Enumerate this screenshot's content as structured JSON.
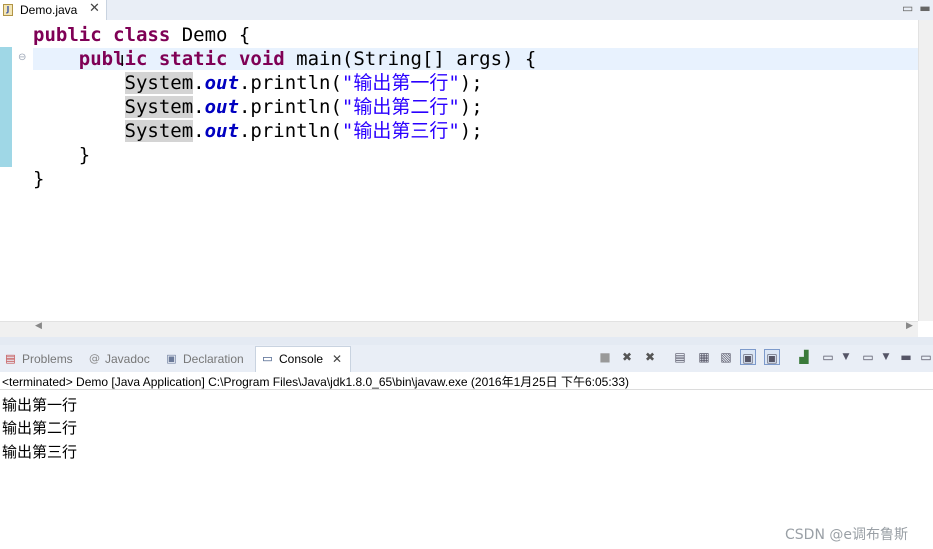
{
  "editor": {
    "tab_label": "Demo.java",
    "tab_icon": "java-file-icon",
    "close_glyph": "✕",
    "minmax_glyphs": "▭▬"
  },
  "code": {
    "line1": {
      "kw1": "public",
      "kw2": "class",
      "rest": " Demo {"
    },
    "line2": {
      "kw1": "public",
      "kw2": "static",
      "kw3": "void",
      "rest": " main(String[] args) {"
    },
    "line3": {
      "sys": "System",
      "dot": ".",
      "fld": "out",
      "call": ".println(",
      "str": "\"输出第一行\"",
      "end": ");"
    },
    "line4": {
      "sys": "System",
      "dot": ".",
      "fld": "out",
      "call": ".println(",
      "str": "\"输出第二行\"",
      "end": ");"
    },
    "line5": {
      "sys": "System",
      "dot": ".",
      "fld": "out",
      "call": ".println(",
      "str": "\"输出第三行\"",
      "end": ");"
    },
    "line6": "}",
    "line7": "}"
  },
  "views": {
    "tabs": [
      {
        "label": "Problems",
        "icon": "problems-icon",
        "active": false
      },
      {
        "label": "Javadoc",
        "icon": "javadoc-icon",
        "active": false
      },
      {
        "label": "Declaration",
        "icon": "declaration-icon",
        "active": false
      },
      {
        "label": "Console",
        "icon": "console-icon",
        "active": true
      }
    ],
    "console_close": "✕"
  },
  "console": {
    "header": "<terminated> Demo [Java Application] C:\\Program Files\\Java\\jdk1.8.0_65\\bin\\javaw.exe (2016年1月25日 下午6:05:33)",
    "output": [
      "输出第一行",
      "输出第二行",
      "输出第三行"
    ]
  },
  "watermark": "CSDN @e调布鲁斯",
  "colors": {
    "keyword": "#7f0055",
    "field": "#0000c0",
    "string": "#2a00ff",
    "current_line": "#e8f2fe"
  }
}
